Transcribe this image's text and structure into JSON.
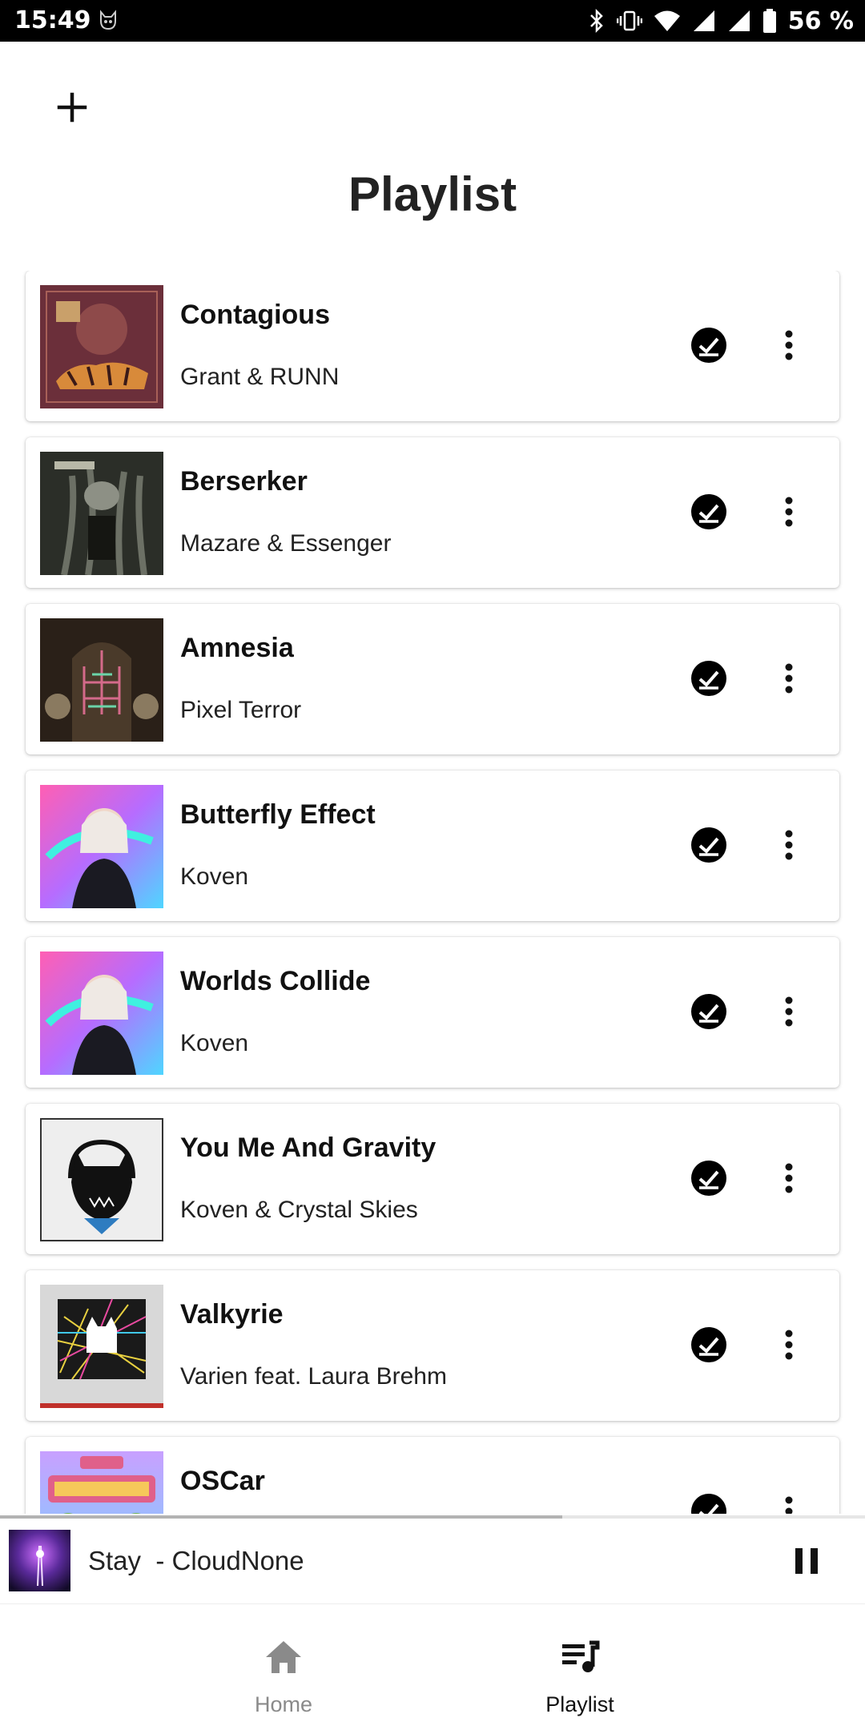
{
  "status_bar": {
    "time": "15:49",
    "battery": "56 %"
  },
  "header": {
    "title": "Playlist"
  },
  "songs": [
    {
      "title": "Contagious",
      "artist": "Grant & RUNN"
    },
    {
      "title": "Berserker",
      "artist": "Mazare & Essenger"
    },
    {
      "title": "Amnesia",
      "artist": "Pixel Terror"
    },
    {
      "title": "Butterfly Effect",
      "artist": "Koven"
    },
    {
      "title": "Worlds Collide",
      "artist": "Koven"
    },
    {
      "title": "You Me And Gravity",
      "artist": "Koven & Crystal Skies"
    },
    {
      "title": "Valkyrie",
      "artist": "Varien feat. Laura Brehm"
    },
    {
      "title": "OSCar",
      "artist": ""
    }
  ],
  "now_playing": {
    "text": "Stay  - CloudNone",
    "progress": 0.65
  },
  "bottom_nav": {
    "home_label": "Home",
    "playlist_label": "Playlist",
    "active": "Playlist"
  },
  "colors": {
    "accent": "#000000",
    "inactive": "#8a8a8a"
  }
}
